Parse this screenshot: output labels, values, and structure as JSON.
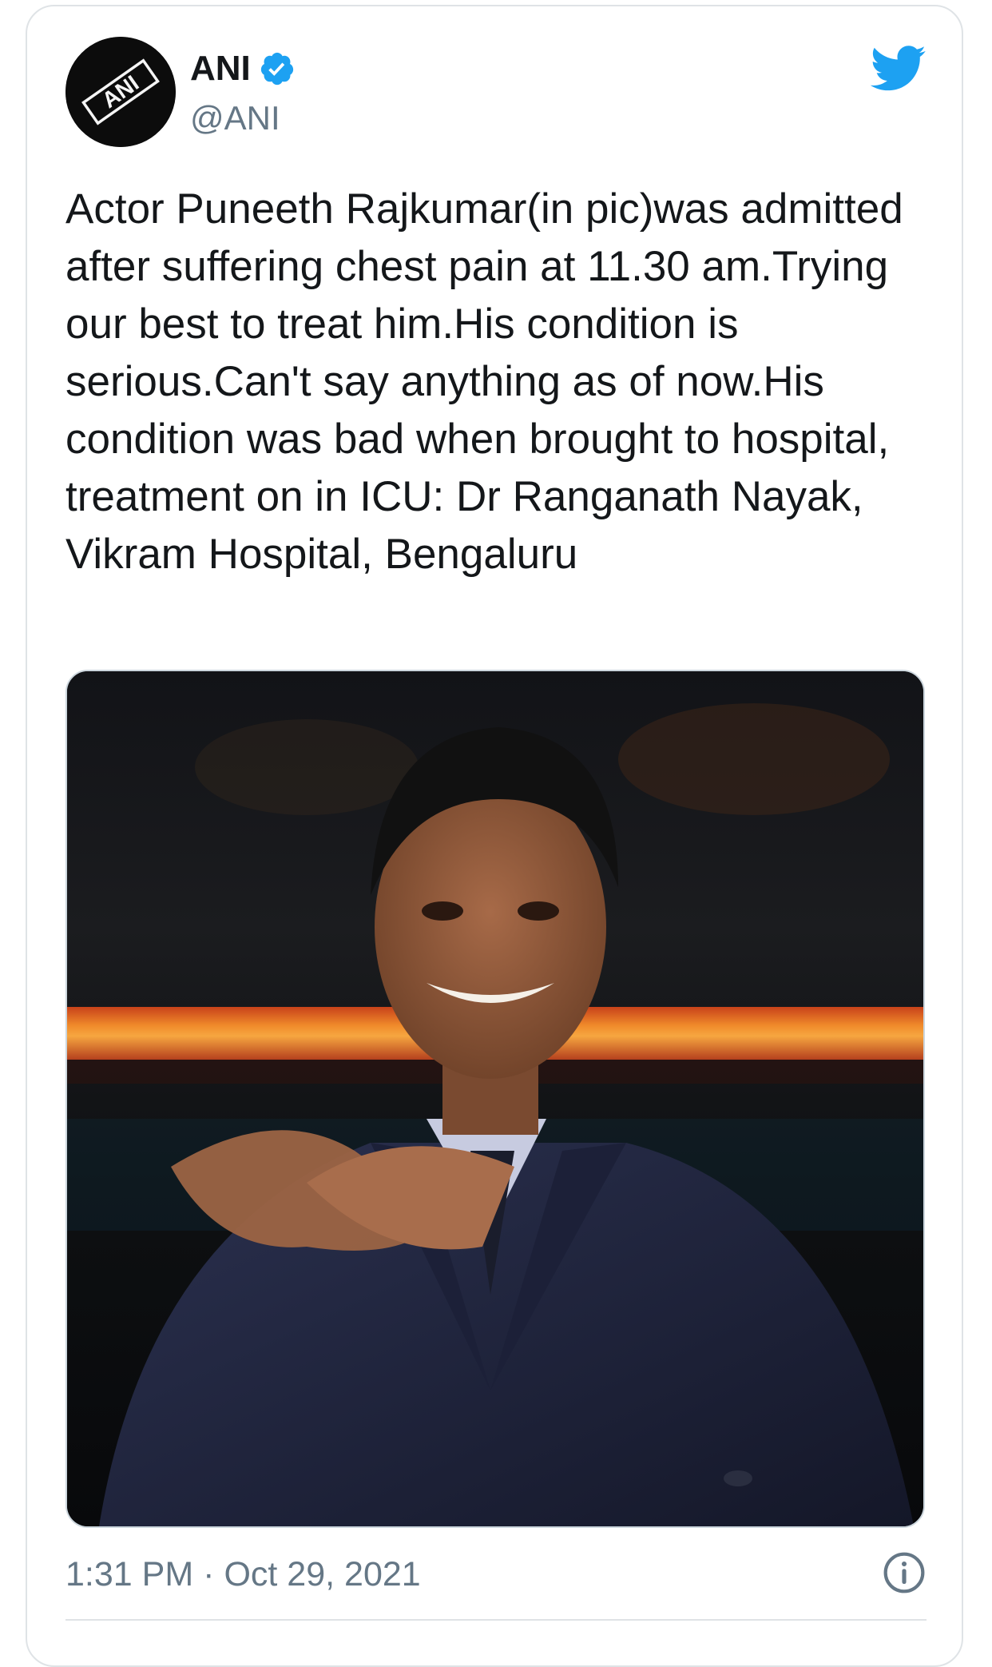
{
  "tweet": {
    "display_name": "ANI",
    "handle": "@ANI",
    "text": "Actor Puneeth Rajkumar(in pic)was admitted after suffering chest pain at 11.30 am.Trying our best to treat him.His condition is serious.Can't say anything as of now.His condition was bad when brought to hospital, treatment on in ICU: Dr Ranganath Nayak, Vikram Hospital, Bengaluru",
    "time": "1:31 PM",
    "separator": "·",
    "date": "Oct 29, 2021"
  },
  "avatar": {
    "logo_text": "ANI"
  },
  "icons": {
    "verified": "verified-badge-icon",
    "brand": "twitter-bird-icon",
    "info": "info-icon"
  },
  "colors": {
    "twitter_blue": "#1da1f2",
    "text": "#14171a",
    "secondary": "#657786",
    "border": "#dfe3e6"
  }
}
